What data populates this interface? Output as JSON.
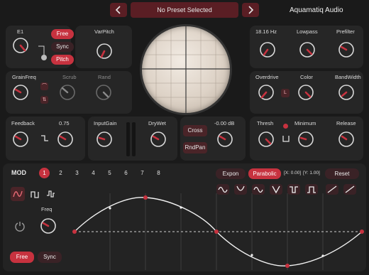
{
  "header": {
    "preset": "No Preset Selected",
    "brand": "Aquamatiq Audio",
    "prev_icon": "chevron-left-icon",
    "next_icon": "chevron-right-icon"
  },
  "grain": {
    "e1": "E1",
    "free": "Free",
    "sync": "Sync",
    "pitch": "Pitch",
    "varpitch": "VarPitch",
    "grainfreq": "GrainFreq",
    "scrub": "Scrub",
    "rand": "Rand"
  },
  "feedback": {
    "label": "Feedback",
    "value": "0.75"
  },
  "gain": {
    "input": "InputGain",
    "drywet": "DryWet"
  },
  "cross": {
    "cross": "Cross",
    "rndpan": "RndPan",
    "db": "-0.00 dB"
  },
  "filter": {
    "freq": "18.16 Hz",
    "lowpass": "Lowpass",
    "prefilter": "Prefilter"
  },
  "drive": {
    "overdrive": "Overdrive",
    "l": "L",
    "color": "Color",
    "bandwidth": "BandWidth"
  },
  "dyn": {
    "thresh": "Thresh",
    "minimum": "Minimum",
    "release": "Release"
  },
  "mod": {
    "title": "MOD",
    "nums": [
      "1",
      "2",
      "3",
      "4",
      "5",
      "6",
      "7",
      "8"
    ],
    "expon": "Expon",
    "parabolic": "Parabolic",
    "x": "[X: 0.00]",
    "y": "[Y: 1.00]",
    "reset": "Reset",
    "freq": "Freq",
    "free": "Free",
    "sync": "Sync"
  },
  "colors": {
    "accent": "#c7323f",
    "panel": "#262626",
    "bg": "#1a1a1a"
  }
}
